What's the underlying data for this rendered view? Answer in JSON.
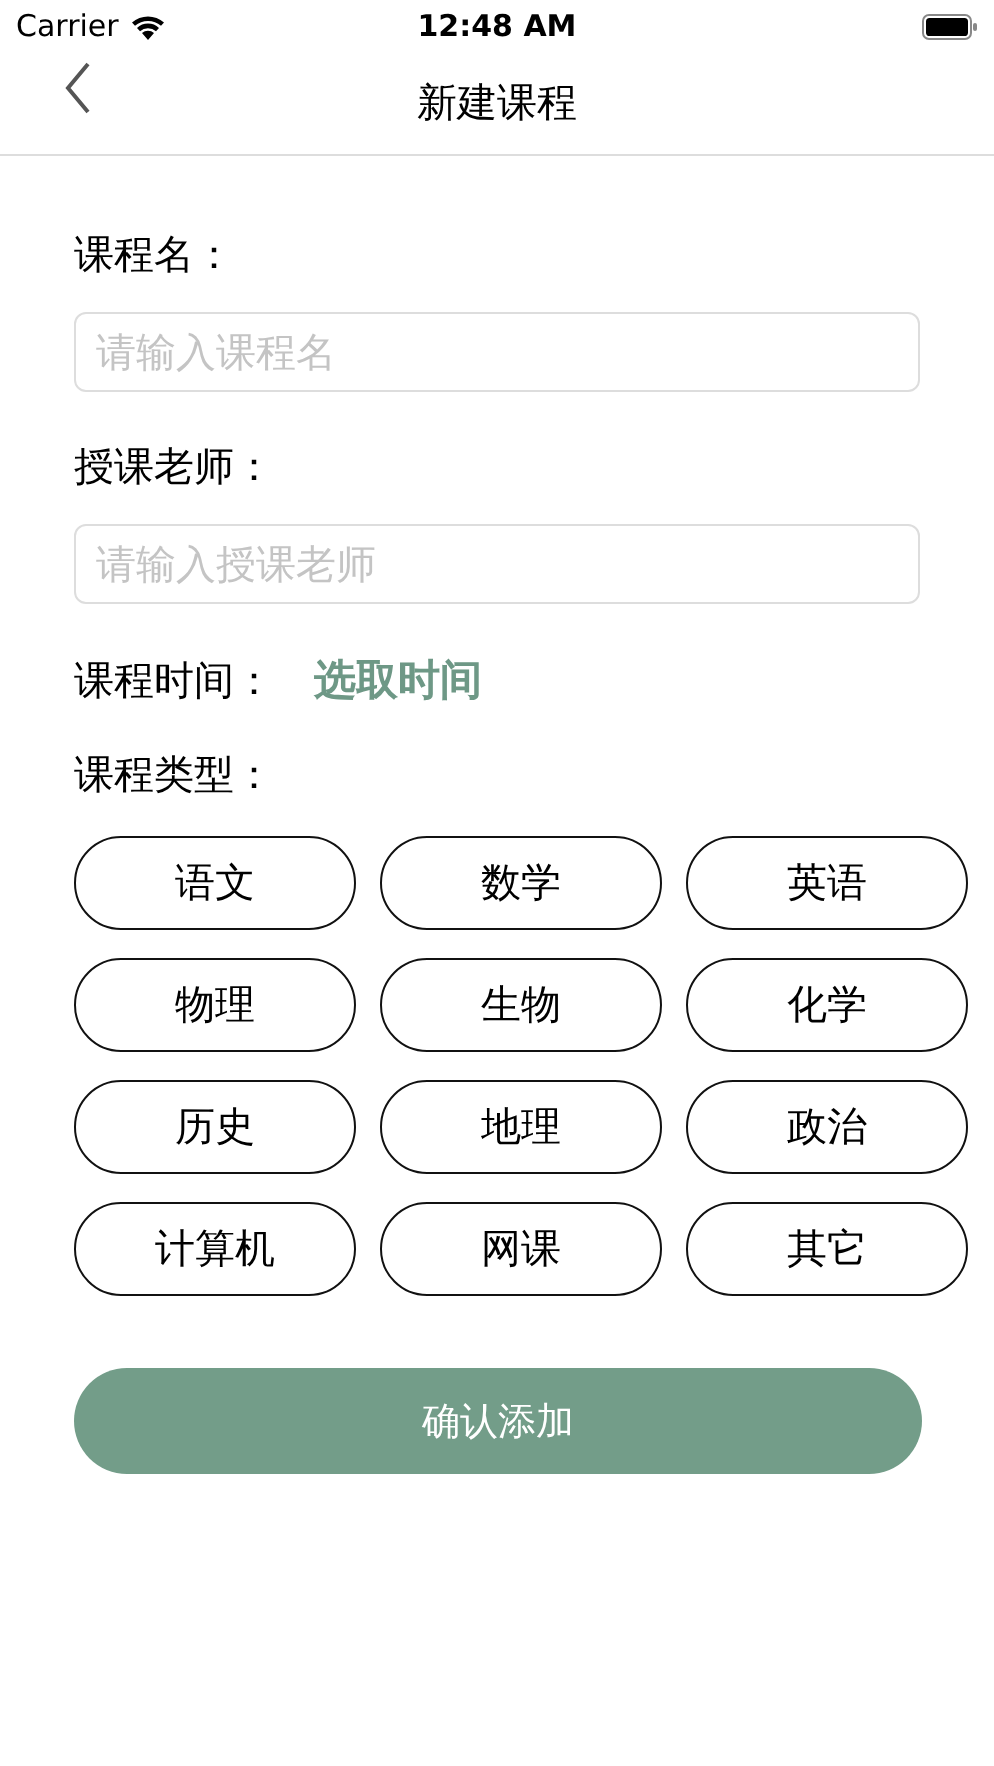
{
  "status_bar": {
    "carrier": "Carrier",
    "time": "12:48 AM"
  },
  "nav": {
    "title": "新建课程"
  },
  "form": {
    "name_label": "课程名：",
    "name_placeholder": "请输入课程名",
    "teacher_label": "授课老师：",
    "teacher_placeholder": "请输入授课老师",
    "time_label": "课程时间：",
    "time_link": "选取时间",
    "type_label": "课程类型："
  },
  "course_types": [
    {
      "label": "语文",
      "selected": false
    },
    {
      "label": "数学",
      "selected": false
    },
    {
      "label": "英语",
      "selected": false
    },
    {
      "label": "物理",
      "selected": false
    },
    {
      "label": "生物",
      "selected": false
    },
    {
      "label": "化学",
      "selected": false
    },
    {
      "label": "历史",
      "selected": false
    },
    {
      "label": "地理",
      "selected": false
    },
    {
      "label": "政治",
      "selected": false
    },
    {
      "label": "计算机",
      "selected": false
    },
    {
      "label": "网课",
      "selected": false
    },
    {
      "label": "其它",
      "selected": false
    }
  ],
  "submit": "确认添加"
}
